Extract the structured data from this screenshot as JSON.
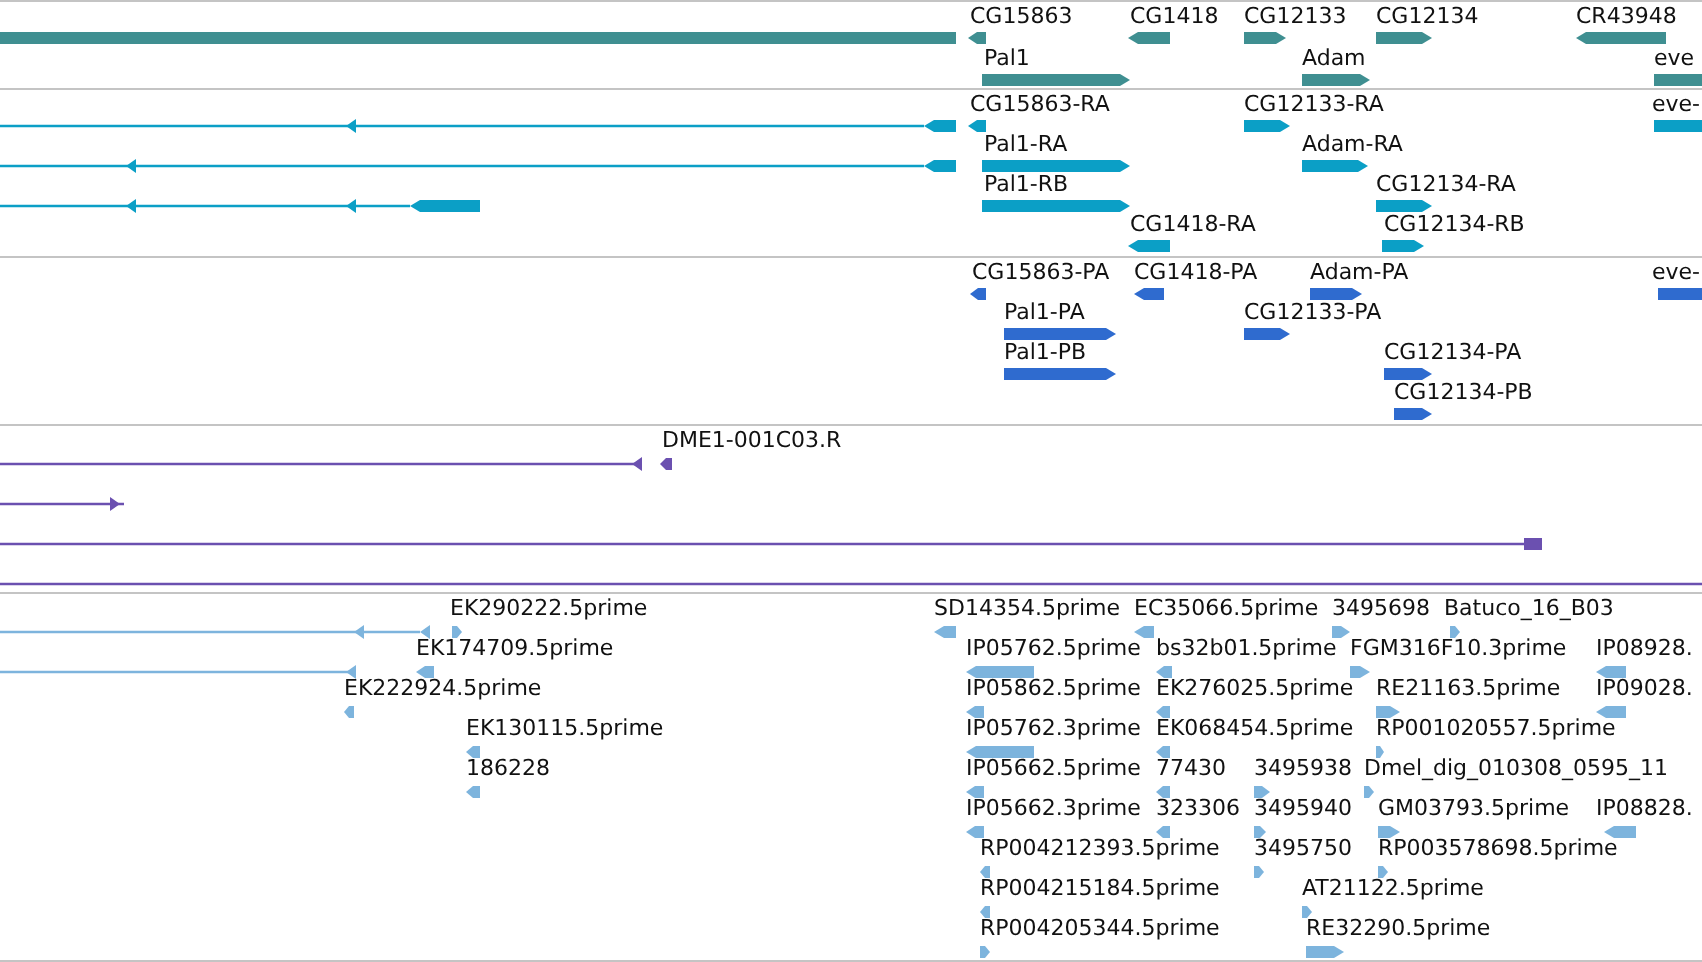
{
  "tracks": [
    {
      "color": "#3f8f91",
      "features": [
        {
          "kind": "block"
        },
        {
          "kind": "block",
          "label": "CG15863",
          "reverse": true
        },
        {
          "kind": "block",
          "label": "CG1418",
          "reverse": true
        },
        {
          "kind": "block",
          "label": "CG12133",
          "reverse": false
        },
        {
          "kind": "block",
          "label": "CG12134",
          "reverse": false
        },
        {
          "kind": "block",
          "label": "CR43948",
          "reverse": true
        },
        {
          "kind": "block",
          "label": "Pal1",
          "reverse": false
        },
        {
          "kind": "block",
          "label": "Adam",
          "reverse": false
        },
        {
          "kind": "block",
          "label": "eve"
        }
      ]
    },
    {
      "color": "#0b9fc6",
      "features": [
        {
          "kind": "line",
          "reverse": true
        },
        {
          "kind": "block",
          "label": "CG15863-RA",
          "reverse": true
        },
        {
          "kind": "block",
          "label": "CG12133-RA",
          "reverse": false
        },
        {
          "kind": "block",
          "label": "eve-"
        },
        {
          "kind": "line",
          "reverse": true
        },
        {
          "kind": "block",
          "label": "Pal1-RA",
          "reverse": false
        },
        {
          "kind": "block",
          "label": "Adam-RA",
          "reverse": false
        },
        {
          "kind": "line",
          "reverse": true
        },
        {
          "kind": "block",
          "label": "Pal1-RB",
          "reverse": false
        },
        {
          "kind": "block",
          "label": "CG12134-RA",
          "reverse": false
        },
        {
          "kind": "block",
          "label": "CG1418-RA",
          "reverse": true
        },
        {
          "kind": "block",
          "label": "CG12134-RB",
          "reverse": false
        }
      ]
    },
    {
      "color": "#2f6bcf",
      "features": [
        {
          "kind": "block",
          "label": "CG15863-PA",
          "reverse": true
        },
        {
          "kind": "block",
          "label": "CG1418-PA",
          "reverse": true
        },
        {
          "kind": "block",
          "label": "Adam-PA",
          "reverse": false
        },
        {
          "kind": "block",
          "label": "eve-"
        },
        {
          "kind": "block",
          "label": "Pal1-PA",
          "reverse": false
        },
        {
          "kind": "block",
          "label": "CG12133-PA",
          "reverse": false
        },
        {
          "kind": "block",
          "label": "Pal1-PB",
          "reverse": false
        },
        {
          "kind": "block",
          "label": "CG12134-PA",
          "reverse": false
        },
        {
          "kind": "block",
          "label": "CG12134-PB",
          "reverse": false
        }
      ]
    },
    {
      "color": "#6b50b0",
      "features": [
        {
          "kind": "line",
          "reverse": true
        },
        {
          "kind": "block",
          "label": "DME1-001C03.R",
          "reverse": true
        },
        {
          "kind": "line",
          "reverse": false
        },
        {
          "kind": "line"
        },
        {
          "kind": "line"
        }
      ]
    },
    {
      "color": "#7db4dd",
      "features": [
        {
          "kind": "line",
          "reverse": true
        },
        {
          "kind": "block",
          "label": "EK290222.5prime",
          "reverse": false
        },
        {
          "kind": "block",
          "label": "SD14354.5prime",
          "reverse": true
        },
        {
          "kind": "block",
          "label": "EC35066.5prime",
          "reverse": true
        },
        {
          "kind": "block",
          "label": "3495698",
          "reverse": false
        },
        {
          "kind": "block",
          "label": "Batuco_16_B03",
          "reverse": false
        },
        {
          "kind": "line",
          "reverse": true
        },
        {
          "kind": "block",
          "label": "EK174709.5prime",
          "reverse": true
        },
        {
          "kind": "block",
          "label": "IP05762.5prime",
          "reverse": true
        },
        {
          "kind": "block",
          "label": "bs32b01.5prime",
          "reverse": true
        },
        {
          "kind": "block",
          "label": "FGM316F10.3prime",
          "reverse": false
        },
        {
          "kind": "block",
          "label": "IP08928.",
          "reverse": true
        },
        {
          "kind": "block",
          "label": "EK222924.5prime",
          "reverse": true
        },
        {
          "kind": "block",
          "label": "IP05862.5prime",
          "reverse": true
        },
        {
          "kind": "block",
          "label": "EK276025.5prime",
          "reverse": true
        },
        {
          "kind": "block",
          "label": "RE21163.5prime",
          "reverse": false
        },
        {
          "kind": "block",
          "label": "IP09028.",
          "reverse": true
        },
        {
          "kind": "block",
          "label": "EK130115.5prime",
          "reverse": true
        },
        {
          "kind": "block",
          "label": "IP05762.3prime",
          "reverse": true
        },
        {
          "kind": "block",
          "label": "EK068454.5prime",
          "reverse": true
        },
        {
          "kind": "block",
          "label": "RP001020557.5prime",
          "reverse": false
        },
        {
          "kind": "block",
          "label": "186228",
          "reverse": true
        },
        {
          "kind": "block",
          "label": "IP05662.5prime",
          "reverse": true
        },
        {
          "kind": "block",
          "label": "77430",
          "reverse": true
        },
        {
          "kind": "block",
          "label": "3495938",
          "reverse": false
        },
        {
          "kind": "block",
          "label": "Dmel_dig_010308_0595_11",
          "reverse": false
        },
        {
          "kind": "block",
          "label": "IP05662.3prime",
          "reverse": true
        },
        {
          "kind": "block",
          "label": "323306",
          "reverse": true
        },
        {
          "kind": "block",
          "label": "3495940",
          "reverse": false
        },
        {
          "kind": "block",
          "label": "GM03793.5prime",
          "reverse": false
        },
        {
          "kind": "block",
          "label": "IP08828.",
          "reverse": true
        },
        {
          "kind": "block",
          "label": "RP004212393.5prime",
          "reverse": true
        },
        {
          "kind": "block",
          "label": "3495750",
          "reverse": false
        },
        {
          "kind": "block",
          "label": "RP003578698.5prime",
          "reverse": false
        },
        {
          "kind": "block",
          "label": "RP004215184.5prime",
          "reverse": true
        },
        {
          "kind": "block",
          "label": "AT21122.5prime",
          "reverse": false
        },
        {
          "kind": "block",
          "label": "RP004205344.5prime",
          "reverse": false
        },
        {
          "kind": "block",
          "label": "RE32290.5prime",
          "reverse": false
        }
      ]
    }
  ]
}
